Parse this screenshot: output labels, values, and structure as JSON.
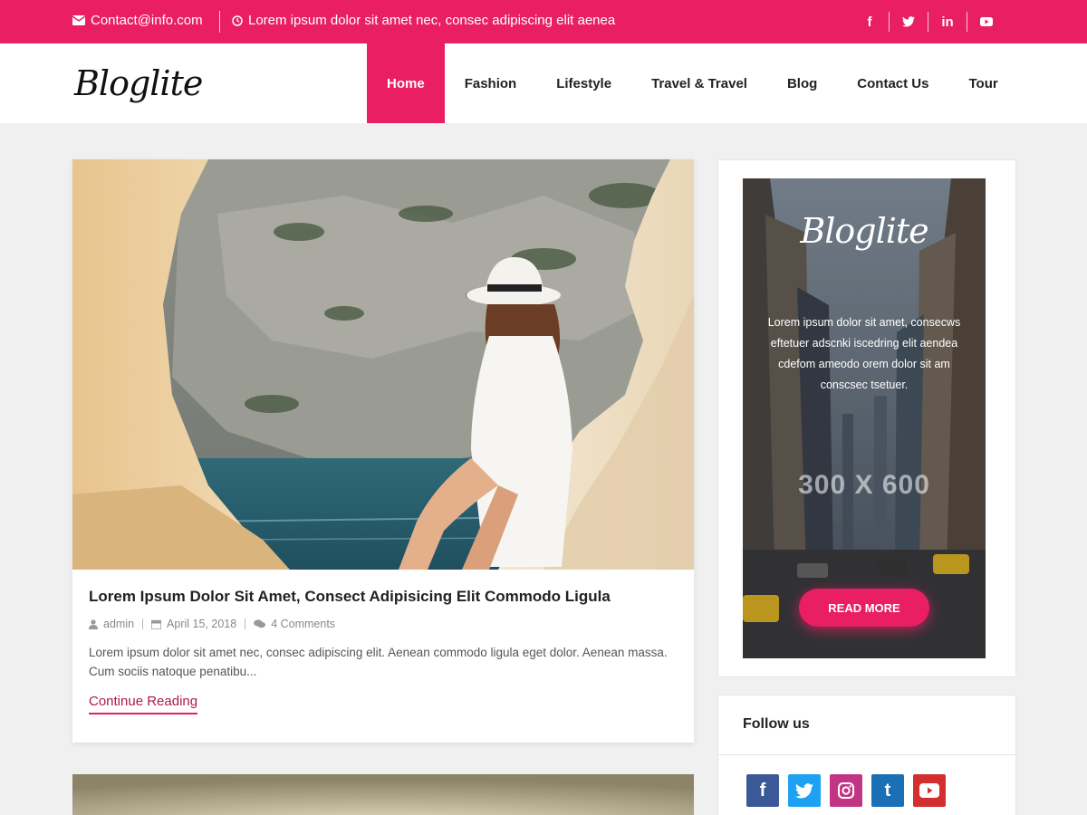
{
  "topbar": {
    "email": "Contact@info.com",
    "tagline": "Lorem ipsum dolor sit amet nec, consec adipiscing elit aenea",
    "social": [
      "facebook-icon",
      "twitter-icon",
      "linkedin-icon",
      "youtube-icon"
    ]
  },
  "header": {
    "logo": "Bloglite",
    "nav": [
      {
        "label": "Home",
        "active": true
      },
      {
        "label": "Fashion"
      },
      {
        "label": "Lifestyle"
      },
      {
        "label": "Travel & Travel"
      },
      {
        "label": "Blog"
      },
      {
        "label": "Contact Us"
      },
      {
        "label": "Tour"
      }
    ]
  },
  "post": {
    "title": "Lorem Ipsum Dolor Sit Amet, Consect Adipisicing Elit Commodo Ligula",
    "author": "admin",
    "date": "April 15, 2018",
    "comments": "4 Comments",
    "excerpt": "Lorem ipsum dolor sit amet nec, consec adipiscing elit. Aenean commodo ligula eget dolor. Aenean massa. Cum sociis natoque penatibu...",
    "read_more": "Continue Reading"
  },
  "ad": {
    "logo": "Bloglite",
    "text": "Lorem ipsum dolor sit amet, consecws eftetuer adscnki iscedring elit aendea cdefom ameodo orem dolor sit am conscsec tsetuer.",
    "size": "300 X 600",
    "button": "READ MORE"
  },
  "follow": {
    "title": "Follow us",
    "icons": [
      {
        "name": "facebook-icon",
        "color": "#3b5998"
      },
      {
        "name": "twitter-icon",
        "color": "#1da1f2"
      },
      {
        "name": "instagram-icon",
        "color": "#c13584"
      },
      {
        "name": "tumblr-icon",
        "color": "#1b6fb5"
      },
      {
        "name": "youtube-icon",
        "color": "#d32f2f"
      }
    ]
  },
  "colors": {
    "accent": "#e91e63",
    "link": "#b0174f"
  }
}
